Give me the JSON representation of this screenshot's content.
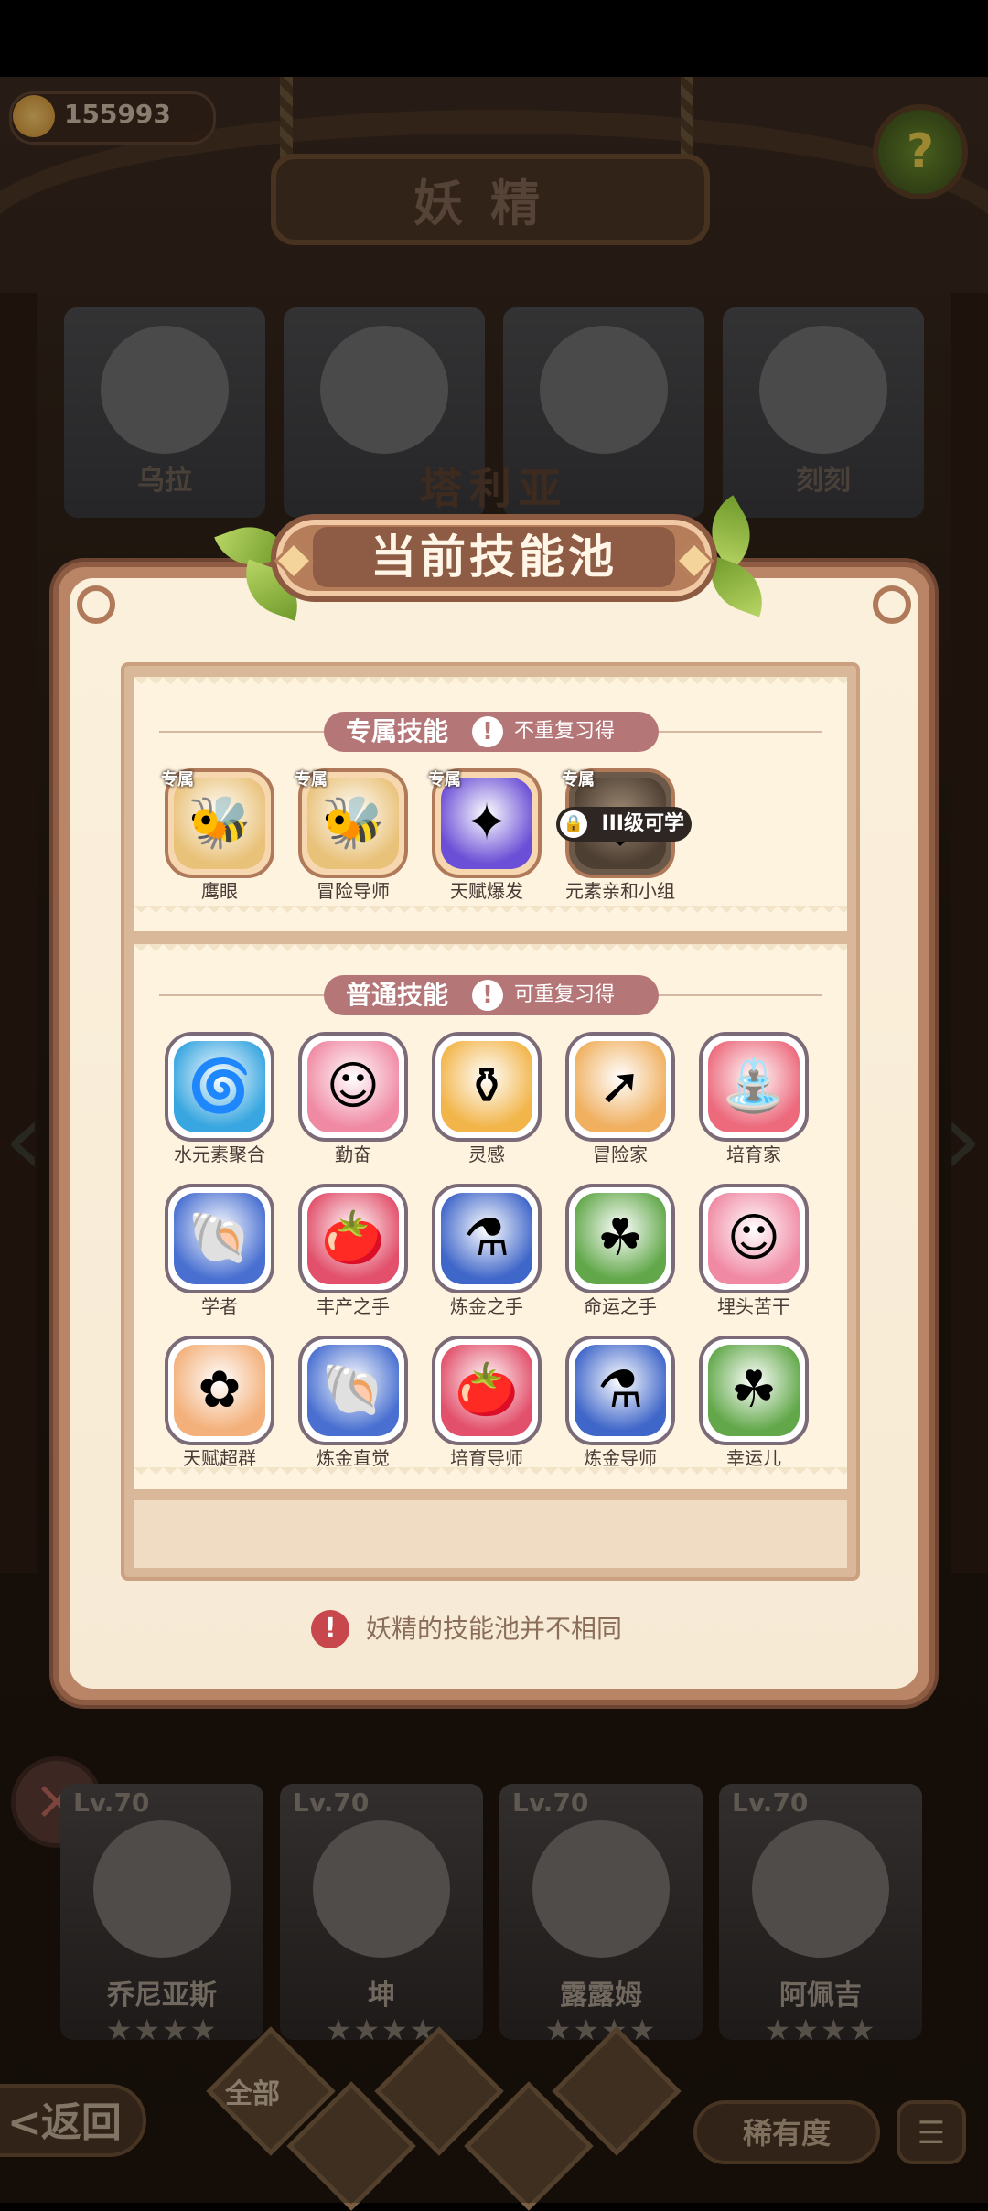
{
  "hud": {
    "coins": "155993",
    "help_glyph": "?"
  },
  "header": {
    "title": "妖精"
  },
  "top_cards": [
    {
      "name": "乌拉"
    },
    {
      "name": ""
    },
    {
      "name": ""
    },
    {
      "name": "刻刻"
    }
  ],
  "behind_name": "塔利亚",
  "dialog": {
    "title": "当前技能池",
    "exclusive": {
      "title": "专属技能",
      "note": "不重复习得",
      "tag": "专属",
      "skills": [
        {
          "name": "鹰眼",
          "icon": "bee-icon",
          "glyph": "🐝",
          "color": "#e9c27a"
        },
        {
          "name": "冒险导师",
          "icon": "bee-icon",
          "glyph": "🐝",
          "color": "#e9c27a"
        },
        {
          "name": "天赋爆发",
          "icon": "burst-figure-icon",
          "glyph": "✦",
          "color": "#6b4fd6"
        },
        {
          "name": "元素亲和小组",
          "icon": "element-group-icon",
          "glyph": "◆",
          "color": "#6d5b48",
          "locked": true,
          "lock_text": "III级可学"
        }
      ]
    },
    "normal": {
      "title": "普通技能",
      "note": "可重复习得",
      "skills": [
        {
          "name": "水元素聚合",
          "icon": "water-vortex-icon",
          "glyph": "🌀",
          "color": "#38a6e0"
        },
        {
          "name": "勤奋",
          "icon": "fairy-face-icon",
          "glyph": "☺",
          "color": "#f08aa4"
        },
        {
          "name": "灵感",
          "icon": "cauldron-icon",
          "glyph": "⚱",
          "color": "#f2b54a"
        },
        {
          "name": "冒险家",
          "icon": "arrow-bag-icon",
          "glyph": "➚",
          "color": "#f0b060"
        },
        {
          "name": "培育家",
          "icon": "watering-can-icon",
          "glyph": "⛲",
          "color": "#ec6a7c"
        },
        {
          "name": "学者",
          "icon": "shell-icon",
          "glyph": "🐚",
          "color": "#4970d1"
        },
        {
          "name": "丰产之手",
          "icon": "tomato-icon",
          "glyph": "🍅",
          "color": "#e2506b"
        },
        {
          "name": "炼金之手",
          "icon": "pot-icon",
          "glyph": "⚗",
          "color": "#3f66c9"
        },
        {
          "name": "命运之手",
          "icon": "clover-icon",
          "glyph": "☘",
          "color": "#62a84a"
        },
        {
          "name": "埋头苦干",
          "icon": "fairy-face-icon",
          "glyph": "☺",
          "color": "#f08aa4"
        },
        {
          "name": "天赋超群",
          "icon": "octopus-icon",
          "glyph": "✿",
          "color": "#f3b07a"
        },
        {
          "name": "炼金直觉",
          "icon": "shell-icon",
          "glyph": "🐚",
          "color": "#4970d1"
        },
        {
          "name": "培育导师",
          "icon": "tomato-icon",
          "glyph": "🍅",
          "color": "#e2506b"
        },
        {
          "name": "炼金导师",
          "icon": "pot-icon",
          "glyph": "⚗",
          "color": "#3f66c9"
        },
        {
          "name": "幸运儿",
          "icon": "clover-icon",
          "glyph": "☘",
          "color": "#62a84a"
        }
      ]
    },
    "footer_note": "妖精的技能池并不相同"
  },
  "bottom_cards": [
    {
      "level": "Lv.70",
      "name": "乔尼亚斯",
      "stars": "★★★★"
    },
    {
      "level": "Lv.70",
      "name": "坤",
      "stars": "★★★★"
    },
    {
      "level": "Lv.70",
      "name": "露露姆",
      "stars": "★★★★"
    },
    {
      "level": "Lv.70",
      "name": "阿佩吉",
      "stars": "★★★★"
    }
  ],
  "bottom_bar": {
    "back_label": "<返回",
    "tab_all": "全部",
    "rarity_label": "稀有度",
    "sort_glyph": "☰"
  }
}
